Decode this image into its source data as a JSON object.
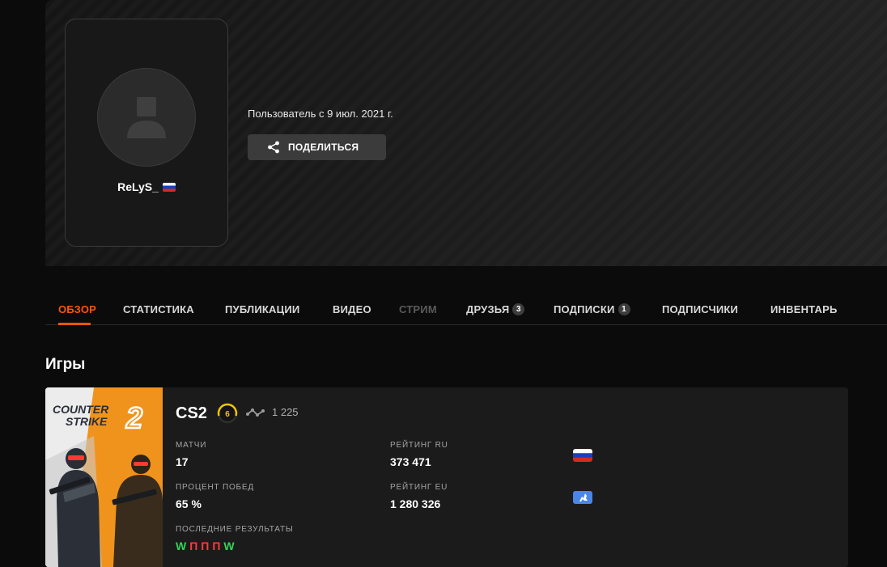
{
  "profile": {
    "username": "ReLyS_",
    "country_flag": "russia-flag",
    "since": "Пользователь с 9 июл. 2021 г.",
    "share_label": "ПОДЕЛИТЬСЯ"
  },
  "tabs": [
    {
      "label": "ОБЗОР",
      "state": "active"
    },
    {
      "label": "СТАТИСТИКА"
    },
    {
      "label": "ПУБЛИКАЦИИ"
    },
    {
      "label": "ВИДЕО"
    },
    {
      "label": "СТРИМ",
      "state": "disabled"
    },
    {
      "label": "ДРУЗЬЯ",
      "badge": "3"
    },
    {
      "label": "ПОДПИСКИ",
      "badge": "1"
    },
    {
      "label": "ПОДПИСЧИКИ"
    },
    {
      "label": "ИНВЕНТАРЬ"
    }
  ],
  "games": {
    "title": "Игры",
    "items": [
      {
        "cover_text": [
          "COUNTER",
          "STRIKE",
          "2"
        ],
        "name": "CS2",
        "level": "6",
        "elo": "1 225",
        "stats": {
          "matches_label": "МАТЧИ",
          "matches": "17",
          "winrate_label": "ПРОЦЕНТ ПОБЕД",
          "winrate": "65 %",
          "rating_ru_label": "РЕЙТИНГ RU",
          "rating_ru": "373 471",
          "rating_eu_label": "РЕЙТИНГ EU",
          "rating_eu": "1 280 326",
          "recent_label": "ПОСЛЕДНИЕ РЕЗУЛЬТАТЫ",
          "recent": [
            "W",
            "П",
            "П",
            "П",
            "W"
          ]
        }
      }
    ]
  },
  "colors": {
    "accent": "#ff5500",
    "win": "#32d35a",
    "loss": "#ff3b3b",
    "level": "#f5c400"
  }
}
